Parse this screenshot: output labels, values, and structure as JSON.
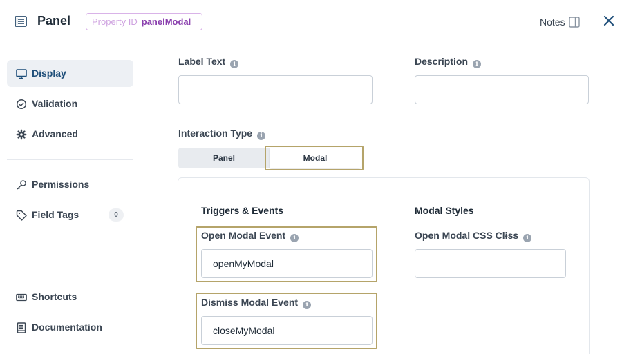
{
  "header": {
    "title": "Panel",
    "property_id_key": "Property ID",
    "property_id_value": "panelModal",
    "notes_label": "Notes"
  },
  "sidebar": {
    "items": [
      {
        "label": "Display",
        "icon": "monitor-icon",
        "active": true
      },
      {
        "label": "Validation",
        "icon": "check-circle-icon"
      },
      {
        "label": "Advanced",
        "icon": "gear-icon"
      },
      {
        "label": "Permissions",
        "icon": "key-icon"
      },
      {
        "label": "Field Tags",
        "icon": "tag-icon",
        "count": "0"
      },
      {
        "label": "Shortcuts",
        "icon": "keyboard-icon"
      },
      {
        "label": "Documentation",
        "icon": "document-icon"
      }
    ]
  },
  "main": {
    "label_text": {
      "label": "Label Text",
      "value": ""
    },
    "description": {
      "label": "Description",
      "value": ""
    },
    "interaction_type": {
      "label": "Interaction Type",
      "options": [
        "Panel",
        "Modal"
      ],
      "selected": "Modal"
    },
    "triggers_events": {
      "heading": "Triggers & Events",
      "open_modal_event": {
        "label": "Open Modal Event",
        "value": "openMyModal"
      },
      "dismiss_modal_event": {
        "label": "Dismiss Modal Event",
        "value": "closeMyModal"
      }
    },
    "modal_styles": {
      "heading": "Modal Styles",
      "open_modal_css_class": {
        "label": "Open Modal CSS Clɨss",
        "value": ""
      }
    },
    "info_glyph": "i"
  },
  "colors": {
    "accent": "#1f4f7a",
    "highlight": "#b5a46a",
    "badge_border": "#d9b3e8",
    "badge_value": "#8a3fae"
  }
}
